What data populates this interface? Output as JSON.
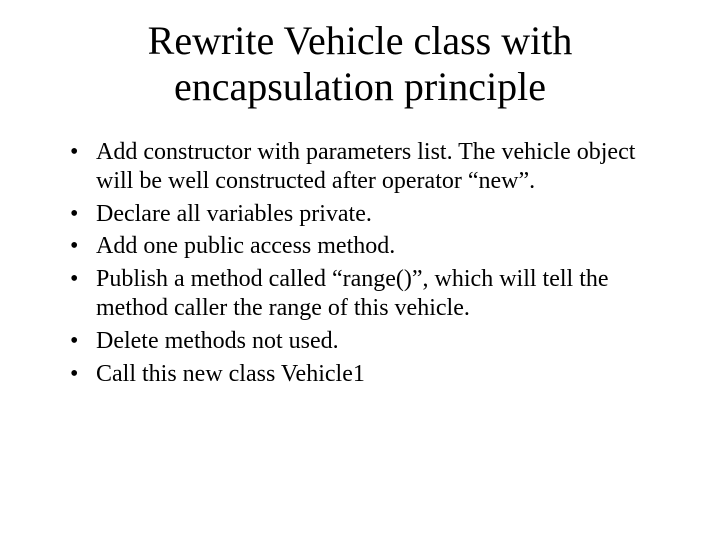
{
  "title_line1": "Rewrite Vehicle class with",
  "title_line2": "encapsulation principle",
  "bullets": [
    "Add constructor with parameters list. The vehicle object will be well constructed after operator “new”.",
    "Declare all variables private.",
    "Add one public access method.",
    "Publish a method called “range()”, which will tell the method caller the range of this vehicle.",
    "Delete methods not used.",
    "Call this new class Vehicle1"
  ]
}
